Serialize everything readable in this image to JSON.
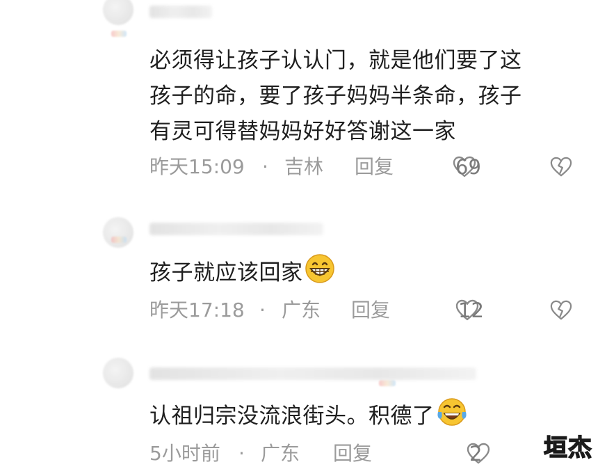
{
  "comments": [
    {
      "text_lines": [
        "必须得让孩子认认门，就是他们要了这",
        "孩子的命，要了孩子妈妈半条命，孩子",
        "有灵可得替妈妈好好答谢这一家"
      ],
      "time": "昨天15:09",
      "dot": "·",
      "location": "吉林",
      "reply_label": "回复",
      "likes": "69",
      "emoji": ""
    },
    {
      "text_lines": [
        "孩子就应该回家"
      ],
      "time": "昨天17:18",
      "dot": "·",
      "location": "广东",
      "reply_label": "回复",
      "likes": "12",
      "emoji": "grinning-face-emoji"
    },
    {
      "text_lines": [
        "认祖归宗没流浪街头。积德了"
      ],
      "time": "5小时前",
      "dot": "·",
      "location": "广东",
      "reply_label": "回复",
      "likes": "2",
      "emoji": "tears-of-joy-emoji"
    }
  ],
  "watermark": "垣杰",
  "colors": {
    "text": "#1f1f1f",
    "meta": "#9b9b9b",
    "emoji_yellow": "#f7c531",
    "tear_blue": "#5aa9e6"
  }
}
